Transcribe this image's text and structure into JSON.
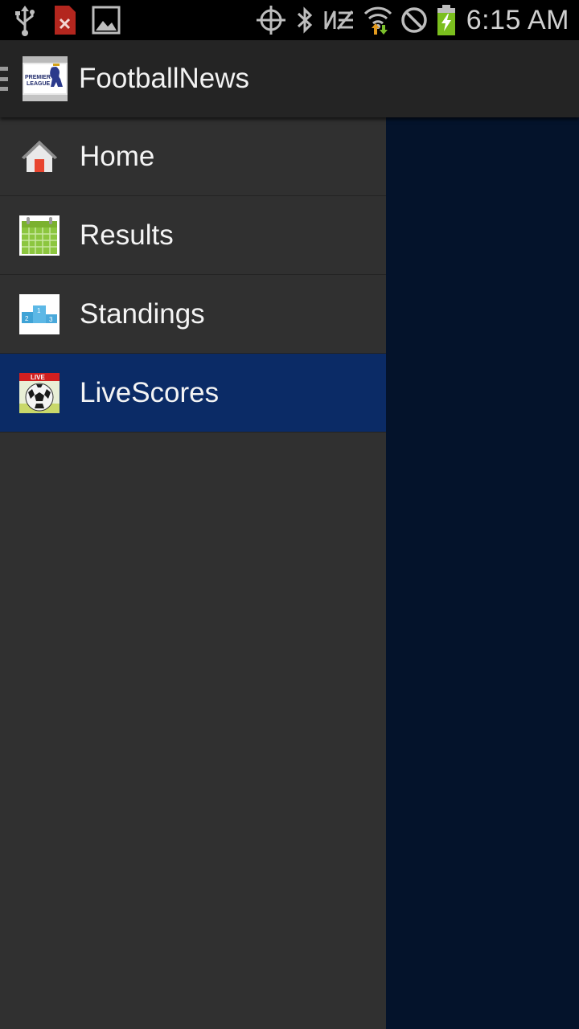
{
  "status_bar": {
    "time": "6:15 AM",
    "left_icons": [
      "usb-icon",
      "sd-card-error-icon",
      "image-icon"
    ],
    "right_icons": [
      "gps-icon",
      "bluetooth-icon",
      "nfc-icon",
      "wifi-icon",
      "blocked-icon",
      "battery-charging-icon"
    ]
  },
  "action_bar": {
    "title": "FootballNews",
    "logo": "premier-league-logo",
    "logo_text_1": "PREMIER",
    "logo_text_2": "LEAGUE"
  },
  "drawer": {
    "items": [
      {
        "label": "Home",
        "icon": "home-icon",
        "selected": false
      },
      {
        "label": "Results",
        "icon": "calendar-icon",
        "selected": false
      },
      {
        "label": "Standings",
        "icon": "podium-icon",
        "selected": false
      },
      {
        "label": "LiveScores",
        "icon": "live-soccer-ball-icon",
        "selected": true
      }
    ],
    "podium_numbers": [
      "1",
      "2",
      "3"
    ],
    "live_badge": "LIVE"
  },
  "colors": {
    "drawer_background": "#303030",
    "selected_item": "#0b2b66",
    "content_background": "#04132b",
    "action_bar": "#242424"
  }
}
